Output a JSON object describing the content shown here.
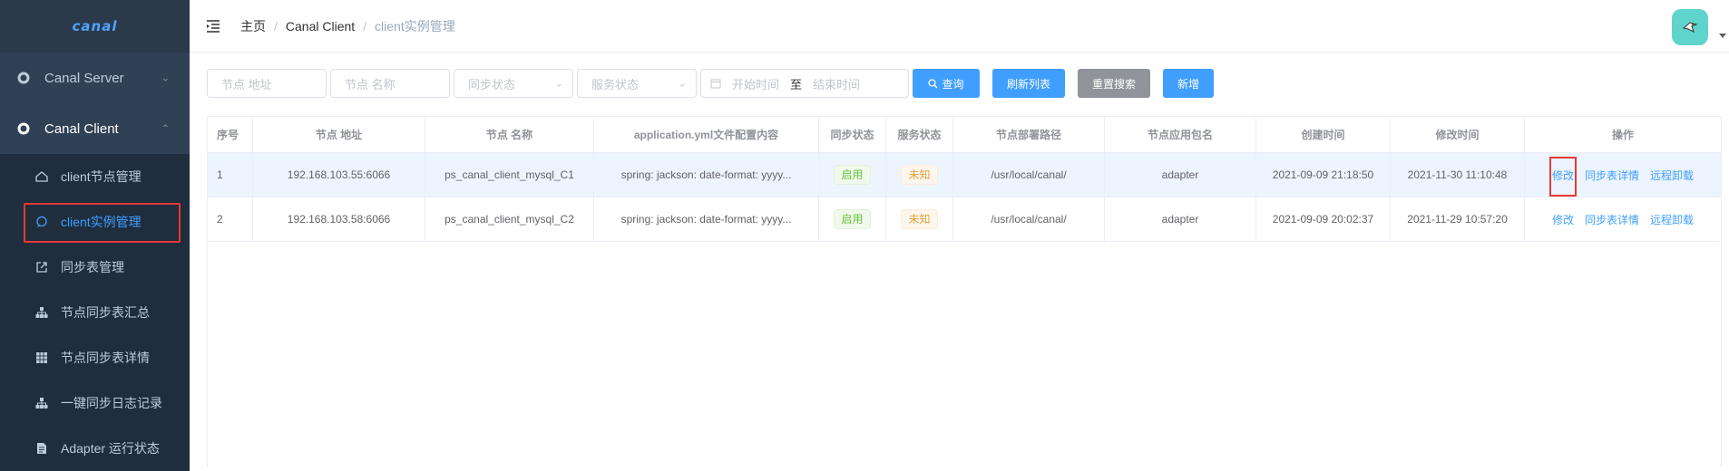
{
  "sidebar": {
    "logo": "canal",
    "menus": [
      {
        "label": "Canal Server",
        "icon": "gear-icon",
        "expanded": false
      },
      {
        "label": "Canal Client",
        "icon": "gear-icon",
        "expanded": true
      }
    ],
    "items": [
      {
        "label": "client节点管理",
        "icon": "home-icon"
      },
      {
        "label": "client实例管理",
        "icon": "chat-icon",
        "active": true
      },
      {
        "label": "同步表管理",
        "icon": "external-link-icon"
      },
      {
        "label": "节点同步表汇总",
        "icon": "tree-icon"
      },
      {
        "label": "节点同步表详情",
        "icon": "grid-icon"
      },
      {
        "label": "一键同步日志记录",
        "icon": "tree-icon"
      },
      {
        "label": "Adapter 运行状态",
        "icon": "document-icon"
      }
    ]
  },
  "breadcrumb": {
    "home": "主页",
    "section": "Canal Client",
    "current": "client实例管理"
  },
  "filters": {
    "node_address": "节点 地址",
    "node_name": "节点 名称",
    "sync_status": "同步状态",
    "service_status": "服务状态",
    "start_time": "开始时间",
    "range_sep": "至",
    "end_time": "结束时间",
    "search_btn": "查询",
    "refresh_btn": "刷新列表",
    "reset_btn": "重置搜索",
    "add_btn": "新增"
  },
  "table": {
    "headers": [
      "序号",
      "节点 地址",
      "节点 名称",
      "application.yml文件配置内容",
      "同步状态",
      "服务状态",
      "节点部署路径",
      "节点应用包名",
      "创建时间",
      "修改时间",
      "操作"
    ],
    "rows": [
      {
        "index": "1",
        "address": "192.168.103.55:6066",
        "name": "ps_canal_client_mysql_C1",
        "config": "spring: jackson: date-format: yyyy...",
        "sync": "启用",
        "service": "未知",
        "path": "/usr/local/canal/",
        "package": "adapter",
        "created": "2021-09-09 21:18:50",
        "modified": "2021-11-30 11:10:48"
      },
      {
        "index": "2",
        "address": "192.168.103.58:6066",
        "name": "ps_canal_client_mysql_C2",
        "config": "spring: jackson: date-format: yyyy...",
        "sync": "启用",
        "service": "未知",
        "path": "/usr/local/canal/",
        "package": "adapter",
        "created": "2021-09-09 20:02:37",
        "modified": "2021-11-29 10:57:20"
      }
    ],
    "actions": {
      "edit": "修改",
      "details": "同步表详情",
      "uninstall": "远程卸载"
    }
  }
}
